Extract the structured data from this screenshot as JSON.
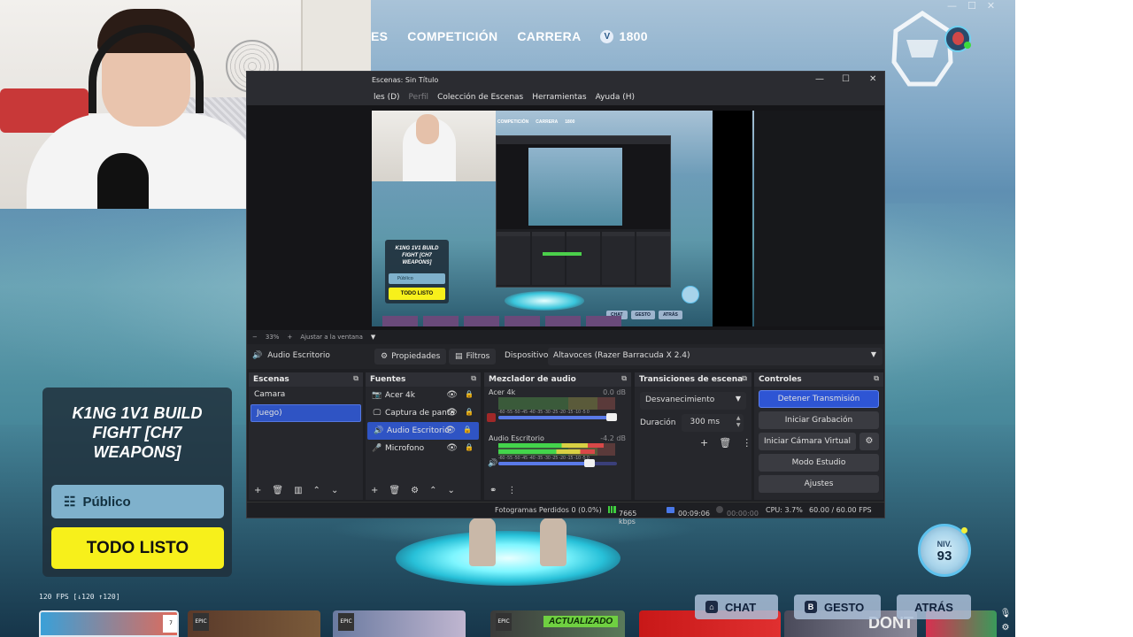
{
  "game": {
    "nav": [
      "ES",
      "COMPETICIÓN",
      "CARRERA"
    ],
    "vbucks": "1800",
    "vbucks_icon": "vbucks-icon",
    "lobby_title": "K1NG 1V1 BUILD FIGHT [CH7 WEAPONS]",
    "privacy_label": "Público",
    "ready_label": "TODO LISTO",
    "fps": "120 FPS [↓120 ↑120]",
    "level_label": "NIV.",
    "level_value": "93",
    "updated_badge": "ACTUALIZADO",
    "chat_key": "",
    "chat_label": "CHAT",
    "emote_key": "B",
    "emote_label": "GESTO",
    "back_label": "ATRÁS",
    "card_tag": "EPIC",
    "card_dont": "DONT"
  },
  "obs": {
    "title": "Escenas: Sin Título",
    "menu": {
      "modes": "les (D)",
      "profile": "Perfil",
      "scene_collection": "Colección de Escenas",
      "tools": "Herramientas",
      "help": "Ayuda (H)"
    },
    "zoom": {
      "minus": "−",
      "value": "33%",
      "plus": "+",
      "fit": "Ajustar a la ventana"
    },
    "source_bar": {
      "selected": "Audio Escritorio",
      "properties": "Propiedades",
      "filters": "Filtros",
      "device_label": "Dispositivo",
      "device_value": "Altavoces (Razer Barracuda X 2.4)"
    },
    "scenes": {
      "title": "Escenas",
      "items": [
        "Camara",
        "Juego)"
      ],
      "active_index": 1
    },
    "sources": {
      "title": "Fuentes",
      "items": [
        {
          "label": "Acer 4k",
          "icon": "camera-icon"
        },
        {
          "label": "Captura de panta",
          "icon": "monitor-icon"
        },
        {
          "label": "Audio Escritorio",
          "icon": "speaker-icon"
        },
        {
          "label": "Microfono",
          "icon": "microphone-icon"
        }
      ],
      "active_index": 2
    },
    "mixer": {
      "title": "Mezclador de audio",
      "channels": [
        {
          "name": "Acer 4k",
          "db": "0.0 dB",
          "level": 0.0,
          "volume": 1.0,
          "muted": true
        },
        {
          "name": "Audio Escritorio",
          "db": "-4.2 dB",
          "level": 0.9,
          "volume": 0.77,
          "muted": false
        }
      ],
      "scale": "-60 -55 -50 -45 -40 -35 -30 -25 -20 -15 -10 -5 0"
    },
    "transitions": {
      "title": "Transiciones de escena",
      "type": "Desvanecimiento",
      "duration_label": "Duración",
      "duration_value": "300 ms"
    },
    "controls": {
      "title": "Controles",
      "stop_stream": "Detener Transmisión",
      "start_record": "Iniciar Grabación",
      "virtual_cam": "Iniciar Cámara Virtual",
      "studio_mode": "Modo Estudio",
      "settings": "Ajustes"
    },
    "status": {
      "dropped": "Fotogramas Perdidos 0 (0.0%)",
      "bitrate": "7665 kbps",
      "live_time": "00:09:06",
      "rec_time": "00:00:00",
      "cpu": "CPU: 3.7%",
      "fps": "60.00 / 60.00 FPS"
    }
  },
  "mini": {
    "nav": [
      "COMPETICIÓN",
      "CARRERA",
      "1800"
    ],
    "lobby_title": "K1NG 1V1 BUILD FIGHT [CH7 WEAPONS]",
    "privacy_label": "Público",
    "ready_label": "TODO LISTO",
    "buttons": [
      "CHAT",
      "GESTO",
      "ATRÁS"
    ],
    "level": "93"
  },
  "colors": {
    "obs_accent": "#2e55d4",
    "ready_yellow": "#f7f01b",
    "privacy_blue": "#7fb1cc",
    "meter_green": "#43d44b"
  }
}
